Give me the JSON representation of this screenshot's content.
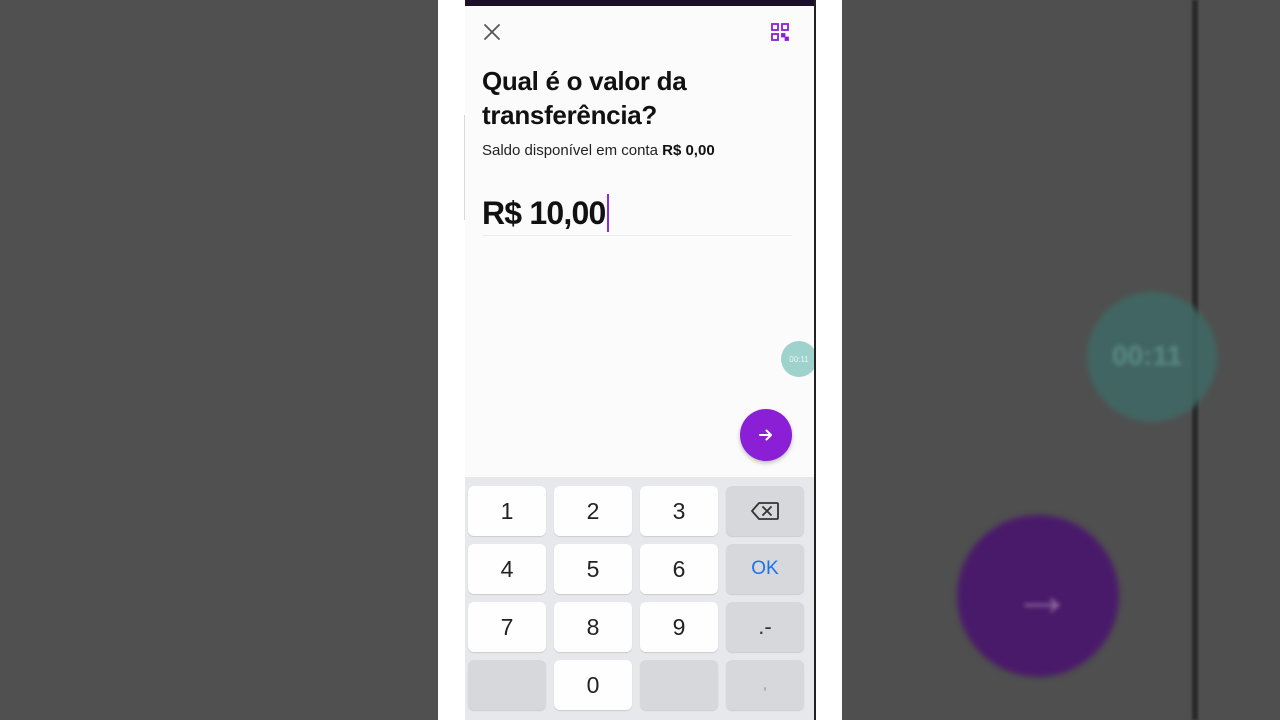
{
  "header": {
    "close_icon": "close-icon",
    "qr_icon": "qr-code-icon"
  },
  "title": "Qual é o valor da transferência?",
  "balance": {
    "label": "Saldo disponível em conta",
    "value": "R$ 0,00"
  },
  "amount": {
    "value": "R$ 10,00"
  },
  "timer": {
    "text": "00:11"
  },
  "next_button": {
    "icon": "arrow-right-icon"
  },
  "keypad": {
    "keys": [
      "1",
      "2",
      "3",
      "4",
      "5",
      "6",
      "7",
      "8",
      "9",
      "0"
    ],
    "ok": "OK",
    "symbols": ".-",
    "comma": ",",
    "backspace_icon": "backspace-icon"
  },
  "background": {
    "ghost_timer": "00:11"
  },
  "colors": {
    "accent": "#8a1fd6",
    "ok_blue": "#1a73e8",
    "timer": "#9fd2cd"
  }
}
